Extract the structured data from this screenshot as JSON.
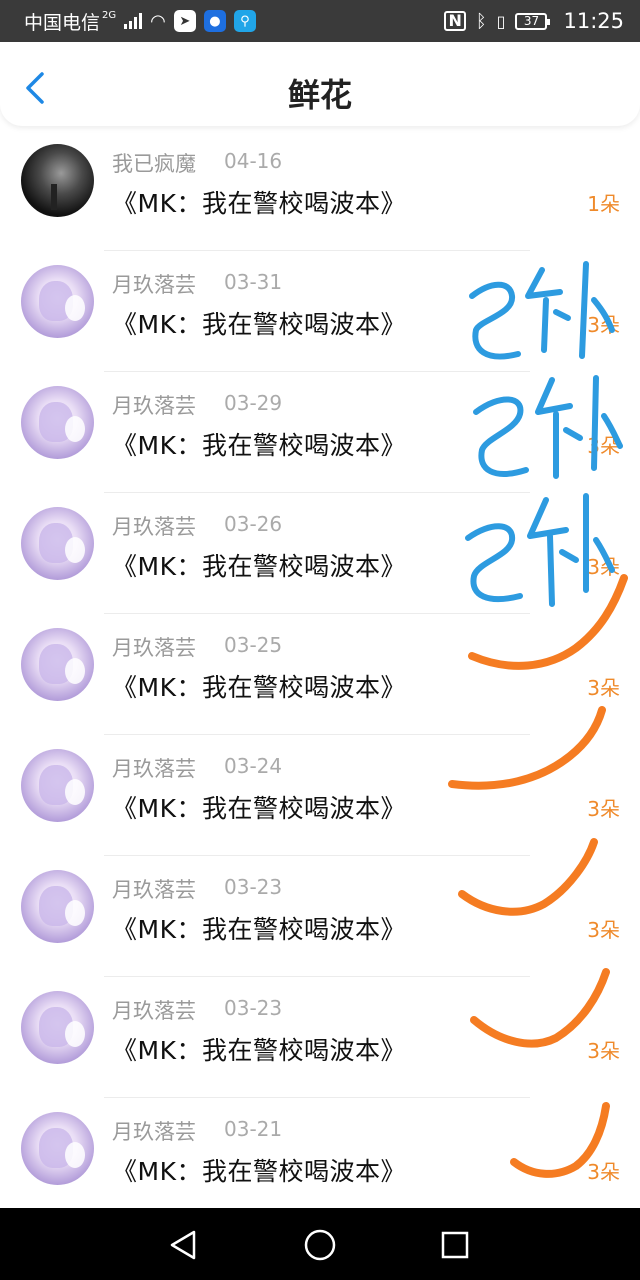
{
  "status_bar": {
    "carrier": "中国电信",
    "network": "2G",
    "battery": "37",
    "time": "11:25",
    "icons": [
      "signal-icon",
      "wifi-icon",
      "arrow-app-icon",
      "bulb-app-icon",
      "search-app-icon",
      "nfc-icon",
      "bluetooth-icon",
      "vibrate-icon",
      "battery-icon"
    ]
  },
  "header": {
    "title": "鲜花",
    "back_icon": "chevron-left-icon"
  },
  "list": {
    "items": [
      {
        "name": "我已疯魔",
        "date": "04-16",
        "book": "《MK：我在警校喝波本》",
        "count": "1朵",
        "avatar": "dark"
      },
      {
        "name": "月玖落芸",
        "date": "03-31",
        "book": "《MK：我在警校喝波本》",
        "count": "3朵",
        "avatar": "anime"
      },
      {
        "name": "月玖落芸",
        "date": "03-29",
        "book": "《MK：我在警校喝波本》",
        "count": "3朵",
        "avatar": "anime"
      },
      {
        "name": "月玖落芸",
        "date": "03-26",
        "book": "《MK：我在警校喝波本》",
        "count": "3朵",
        "avatar": "anime"
      },
      {
        "name": "月玖落芸",
        "date": "03-25",
        "book": "《MK：我在警校喝波本》",
        "count": "3朵",
        "avatar": "anime"
      },
      {
        "name": "月玖落芸",
        "date": "03-24",
        "book": "《MK：我在警校喝波本》",
        "count": "3朵",
        "avatar": "anime"
      },
      {
        "name": "月玖落芸",
        "date": "03-23",
        "book": "《MK：我在警校喝波本》",
        "count": "3朵",
        "avatar": "anime"
      },
      {
        "name": "月玖落芸",
        "date": "03-23",
        "book": "《MK：我在警校喝波本》",
        "count": "3朵",
        "avatar": "anime"
      },
      {
        "name": "月玖落芸",
        "date": "03-21",
        "book": "《MK：我在警校喝波本》",
        "count": "3朵",
        "avatar": "anime"
      }
    ]
  },
  "colors": {
    "accent": "#1e88e5",
    "count": "#ef8a2b",
    "scribble_blue": "#2d9be0",
    "scribble_orange": "#f57c22"
  },
  "nav_bar": {
    "icons": [
      "back-triangle-icon",
      "home-circle-icon",
      "recents-square-icon"
    ]
  }
}
